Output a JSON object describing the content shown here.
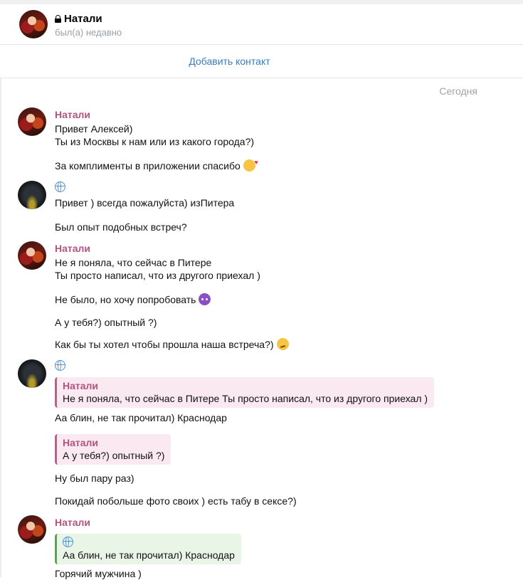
{
  "header": {
    "name": "Натали",
    "status": "был(а) недавно"
  },
  "add_contact_label": "Добавить контакт",
  "date_label": "Сегодня",
  "messages": {
    "m1": {
      "sender": "Натали",
      "lines": [
        "Привет Алексей)",
        "Ты из Москвы к нам или из какого города?)"
      ]
    },
    "m2": {
      "text": "За комплименты в приложении спасибо"
    },
    "m3": {
      "text": "Привет ) всегда пожалуйста) изПитера"
    },
    "m4": {
      "text": "Был опыт подобных встреч?"
    },
    "m5": {
      "sender": "Натали",
      "lines": [
        "Не я поняла, что сейчас в Питере",
        "Ты просто написал, что из другого приехал )"
      ]
    },
    "m6": {
      "text": "Не было, но хочу попробовать"
    },
    "m7": {
      "text": "А у тебя?) опытный ?)"
    },
    "m8": {
      "text": "Как бы ты хотел чтобы прошла наша встреча?)"
    },
    "m9": {
      "quote_sender": "Натали",
      "quote_text": "Не я поняла, что сейчас в Питере  Ты просто написал, что из другого приехал )",
      "text": "Аа блин, не так прочитал) Краснодар"
    },
    "m10": {
      "quote_sender": "Натали",
      "quote_text": "А у тебя?) опытный ?)",
      "text": "Ну был пару раз)"
    },
    "m11": {
      "text": "Покидай побольше фото своих ) есть табу в сексе?)"
    },
    "m12": {
      "sender": "Натали",
      "quote_text": "Аа блин, не так прочитал) Краснодар",
      "text": "Горячий мужчина )"
    }
  },
  "icons": {
    "lock": "lock-icon",
    "globe": "globe-icon",
    "emoji_hearts": "smiling-face-with-hearts-emoji",
    "emoji_devil": "smiling-devil-emoji",
    "emoji_smirk": "smirking-face-emoji"
  },
  "colors": {
    "link": "#3d79bd",
    "sender": "#b1547f",
    "quote_pink_bg": "#fbe9f1",
    "quote_green_bg": "#e9f5e6"
  }
}
